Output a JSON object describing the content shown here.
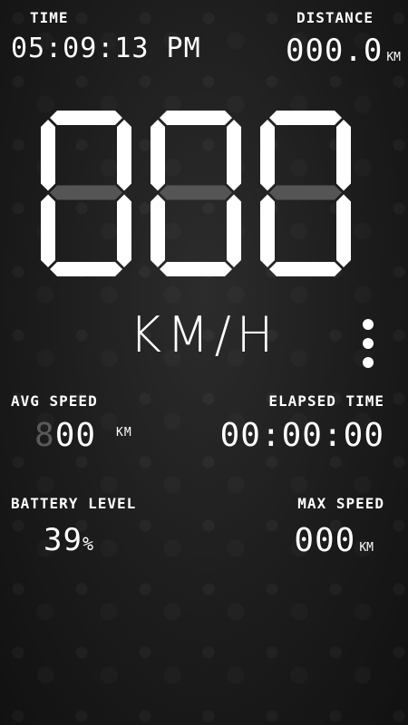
{
  "header": {
    "time_label": "TIME",
    "time_value": "05:09:13 PM",
    "distance_label": "DISTANCE",
    "distance_value": "000.0",
    "distance_unit": "KM"
  },
  "speed": {
    "value": "000",
    "unit": "KM/H"
  },
  "menu": {
    "icon": "more-vertical-icon"
  },
  "stats": {
    "avg_label": "AVG SPEED",
    "avg_ghost": "8",
    "avg_value": "00",
    "avg_unit": "KM",
    "elapsed_label": "ELAPSED TIME",
    "elapsed_value": "00:00:00",
    "battery_label": "BATTERY LEVEL",
    "battery_value": "39",
    "battery_unit": "%",
    "max_label": "MAX SPEED",
    "max_value": "000",
    "max_unit": "KM"
  }
}
